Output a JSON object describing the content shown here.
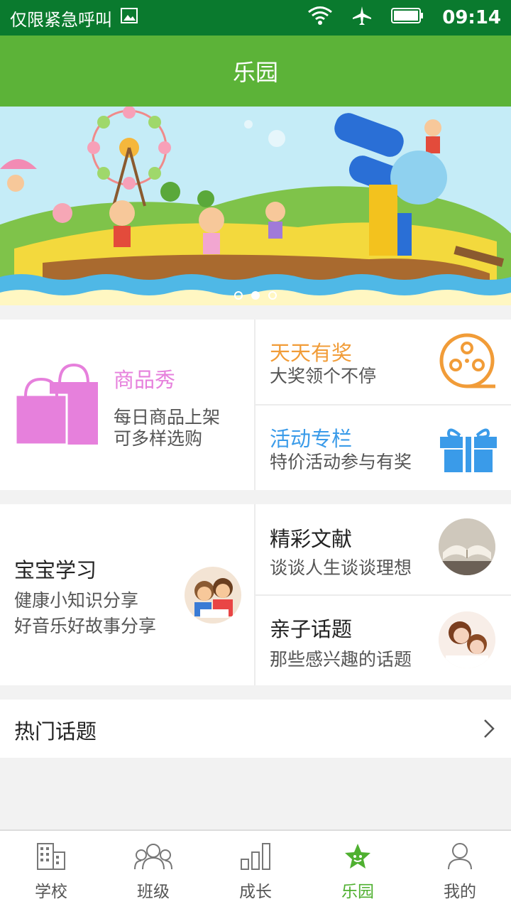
{
  "status_bar": {
    "left_text": "仅限紧急呼叫",
    "time": "09:14"
  },
  "title": "乐园",
  "banner": {
    "dots": 3,
    "active_dot": 1
  },
  "grid1": {
    "left": {
      "title": "商品秀",
      "sub1": "每日商品上架",
      "sub2": "可多样选购",
      "color": "#e67fdc"
    },
    "right_top": {
      "title": "天天有奖",
      "sub": "大奖领个不停",
      "color": "#f19c38"
    },
    "right_bottom": {
      "title": "活动专栏",
      "sub": "特价活动参与有奖",
      "color": "#3a9be9"
    }
  },
  "grid2": {
    "left": {
      "title": "宝宝学习",
      "sub1": "健康小知识分享",
      "sub2": "好音乐好故事分享"
    },
    "right_top": {
      "title": "精彩文献",
      "sub": "谈谈人生谈谈理想"
    },
    "right_bottom": {
      "title": "亲子话题",
      "sub": "那些感兴趣的话题"
    }
  },
  "hot_topics": {
    "label": "热门话题"
  },
  "tabs": [
    {
      "label": "学校",
      "icon": "school-building-icon"
    },
    {
      "label": "班级",
      "icon": "class-people-icon"
    },
    {
      "label": "成长",
      "icon": "growth-bars-icon"
    },
    {
      "label": "乐园",
      "icon": "park-star-icon",
      "active": true
    },
    {
      "label": "我的",
      "icon": "profile-person-icon"
    }
  ],
  "colors": {
    "status_bar": "#0a7a2e",
    "title_bar": "#5cb338",
    "active_tab": "#4fb030"
  }
}
